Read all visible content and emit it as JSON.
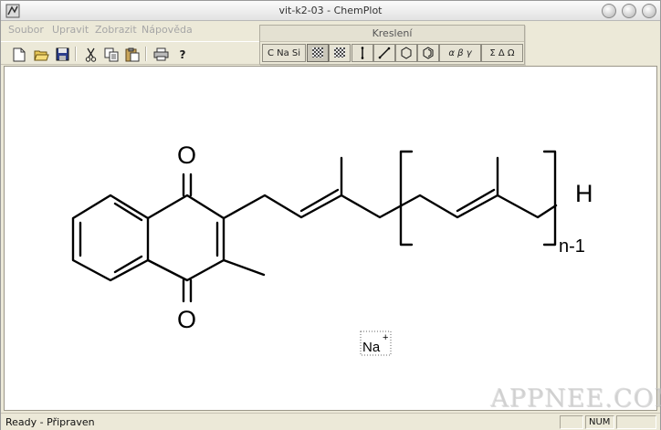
{
  "window": {
    "title": "vit-k2-03 - ChemPlot"
  },
  "menu": {
    "items": [
      "Soubor",
      "Upravit",
      "Zobrazit",
      "Nápověda"
    ]
  },
  "toolbar": {
    "buttons": [
      "new-file",
      "open-folder",
      "save",
      "cut",
      "copy",
      "paste",
      "print",
      "help"
    ],
    "help_glyph": "?"
  },
  "drawing_palette": {
    "title": "Kreslení",
    "buttons": [
      "C Na Si",
      "",
      "",
      "",
      "",
      "",
      "",
      "α β γ",
      "Σ Δ Ω"
    ]
  },
  "molecule": {
    "carbonyl_top": "O",
    "carbonyl_bottom": "O",
    "terminal": "H",
    "repeat_count": "n-1",
    "ion_label": "Na",
    "ion_charge": "+"
  },
  "status": {
    "text": "Ready - Připraven",
    "num": "NUM"
  },
  "watermark": "APPNEE.COM"
}
